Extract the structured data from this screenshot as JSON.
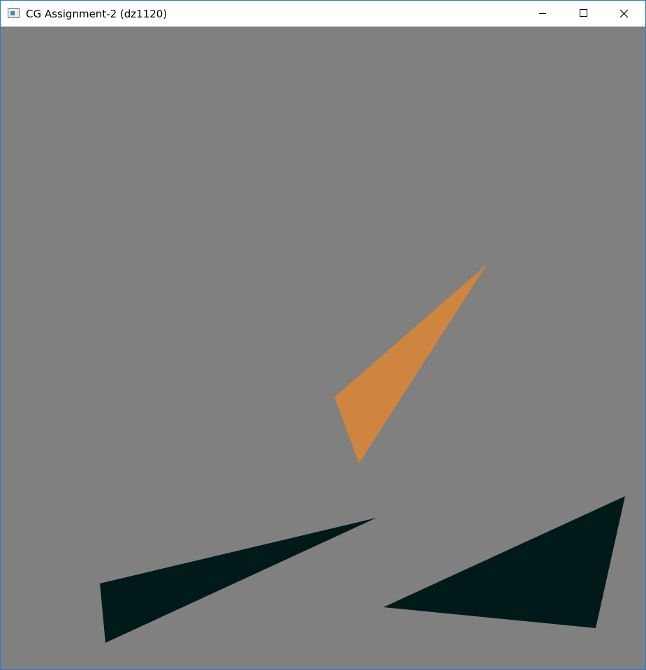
{
  "window": {
    "title": "CG Assignment-2 (dz1120)",
    "controls": {
      "minimize_icon": "minimize-icon",
      "maximize_icon": "maximize-icon",
      "close_icon": "close-icon"
    }
  },
  "canvas": {
    "background_color": "#808080",
    "shapes": [
      {
        "name": "orange-triangle",
        "color": "#cd853f"
      },
      {
        "name": "dark-triangle-left",
        "color": "#001a1a"
      },
      {
        "name": "dark-triangle-right",
        "color": "#001a1a"
      }
    ]
  }
}
